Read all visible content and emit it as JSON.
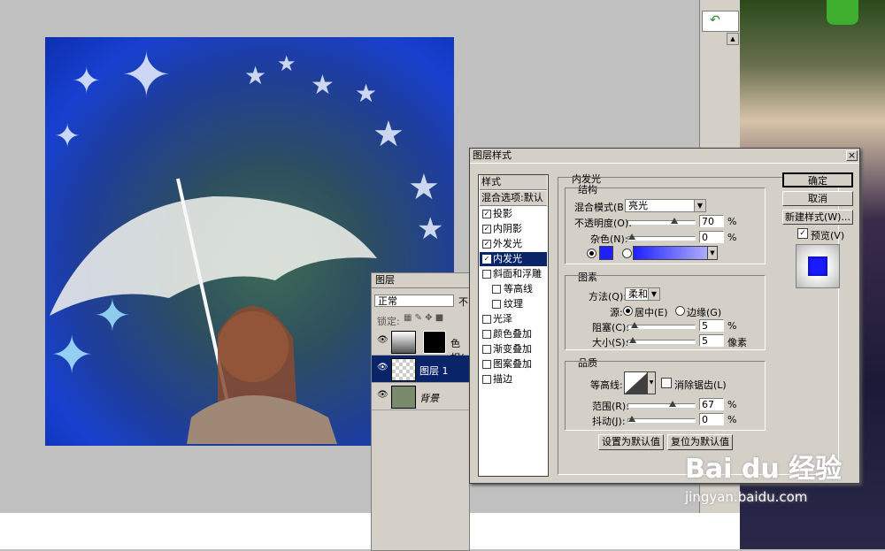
{
  "layers_panel": {
    "tab": "图层",
    "blend_mode": "正常",
    "opacity_label": "不",
    "lock_label": "锁定:",
    "layers": [
      {
        "name": "色相/...",
        "type": "adjustment"
      },
      {
        "name": "图层 1",
        "type": "layer",
        "selected": true
      },
      {
        "name": "背景",
        "type": "background"
      }
    ]
  },
  "dialog": {
    "title": "图层样式",
    "close_label": "×",
    "styles_header": "样式",
    "blend_options": "混合选项:默认",
    "style_items": [
      {
        "label": "投影",
        "checked": true,
        "indent": false
      },
      {
        "label": "内阴影",
        "checked": true,
        "indent": false
      },
      {
        "label": "外发光",
        "checked": true,
        "indent": false
      },
      {
        "label": "内发光",
        "checked": true,
        "indent": false,
        "active": true
      },
      {
        "label": "斜面和浮雕",
        "checked": false,
        "indent": false
      },
      {
        "label": "等高线",
        "checked": false,
        "indent": true
      },
      {
        "label": "纹理",
        "checked": false,
        "indent": true
      },
      {
        "label": "光泽",
        "checked": false,
        "indent": false
      },
      {
        "label": "颜色叠加",
        "checked": false,
        "indent": false
      },
      {
        "label": "渐变叠加",
        "checked": false,
        "indent": false
      },
      {
        "label": "图案叠加",
        "checked": false,
        "indent": false
      },
      {
        "label": "描边",
        "checked": false,
        "indent": false
      }
    ],
    "section_title": "内发光",
    "structure": {
      "title": "结构",
      "blend_mode_label": "混合模式(B):",
      "blend_mode_value": "亮光",
      "opacity_label": "不透明度(O):",
      "opacity_value": "70",
      "opacity_unit": "%",
      "opacity_level": 0.7,
      "noise_label": "杂色(N):",
      "noise_value": "0",
      "noise_unit": "%",
      "noise_level": 0,
      "glow_color": "#2020ff"
    },
    "elements": {
      "title": "图素",
      "method_label": "方法(Q):",
      "method_value": "柔和",
      "source_label": "源:",
      "source_center": "居中(E)",
      "source_edge": "边缘(G)",
      "choke_label": "阻塞(C):",
      "choke_value": "5",
      "choke_unit": "%",
      "choke_level": 0.05,
      "size_label": "大小(S):",
      "size_value": "5",
      "size_unit": "像素",
      "size_level": 0.02
    },
    "quality": {
      "title": "品质",
      "contour_label": "等高线:",
      "antialias_label": "消除锯齿(L)",
      "range_label": "范围(R):",
      "range_value": "67",
      "range_unit": "%",
      "range_level": 0.67,
      "jitter_label": "抖动(J):",
      "jitter_value": "0",
      "jitter_unit": "%",
      "jitter_level": 0
    },
    "set_default": "设置为默认值",
    "reset_default": "复位为默认值",
    "ok": "确定",
    "cancel": "取消",
    "new_style": "新建样式(W)...",
    "preview_label": "预览(V)",
    "preview_checked": true
  },
  "watermark": {
    "brand": "Bai du 经验",
    "url": "jingyan.baidu.com"
  }
}
